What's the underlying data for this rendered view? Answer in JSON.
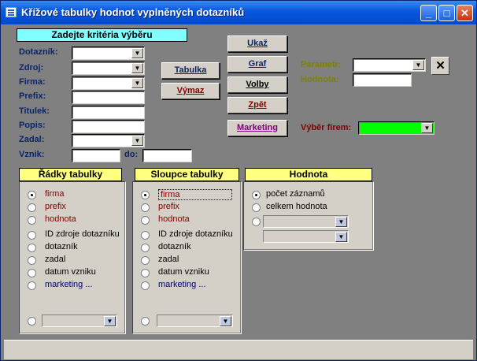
{
  "window": {
    "title": "Křížové tabulky hodnot vyplněných dotazníků",
    "min": "_",
    "max": "□",
    "close": "✕"
  },
  "criteria": {
    "banner": "Zadejte kritéria výběru",
    "labels": {
      "dotaznik": "Dotazník:",
      "zdroj": "Zdroj:",
      "firma": "Firma:",
      "prefix": "Prefix:",
      "titulek": "Titulek:",
      "popis": "Popis:",
      "zadal": "Zadal:",
      "vznik": "Vznik:",
      "do": "do:"
    }
  },
  "buttons": {
    "tabulka": "Tabulka",
    "vymaz": "Výmaz",
    "ukaz": "Ukaž",
    "graf": "Graf",
    "volby": "Volby",
    "zpet": "Zpět",
    "marketing": "Marketing",
    "clear": "✕"
  },
  "params": {
    "parametr": "Parametr:",
    "hodnota": "Hodnota:",
    "vyber_firem": "Výběr firem:"
  },
  "rows_group": {
    "title": "Řádky tabulky",
    "options": [
      "firma",
      "prefix",
      "hodnota",
      "ID zdroje dotazníku",
      "dotazník",
      "zadal",
      "datum vzniku",
      "marketing ..."
    ]
  },
  "cols_group": {
    "title": "Sloupce tabulky",
    "options": [
      "firma",
      "prefix",
      "hodnota",
      "ID zdroje dotazníku",
      "dotazník",
      "zadal",
      "datum vzniku",
      "marketing ..."
    ]
  },
  "value_group": {
    "title": "Hodnota",
    "options": [
      "počet záznamů",
      "celkem hodnota"
    ]
  },
  "colors": {
    "banner": "#80ffff",
    "group_title": "#ffff80",
    "vyber_firem": "#00ff00"
  },
  "icons": {
    "dropdown": "▼"
  }
}
